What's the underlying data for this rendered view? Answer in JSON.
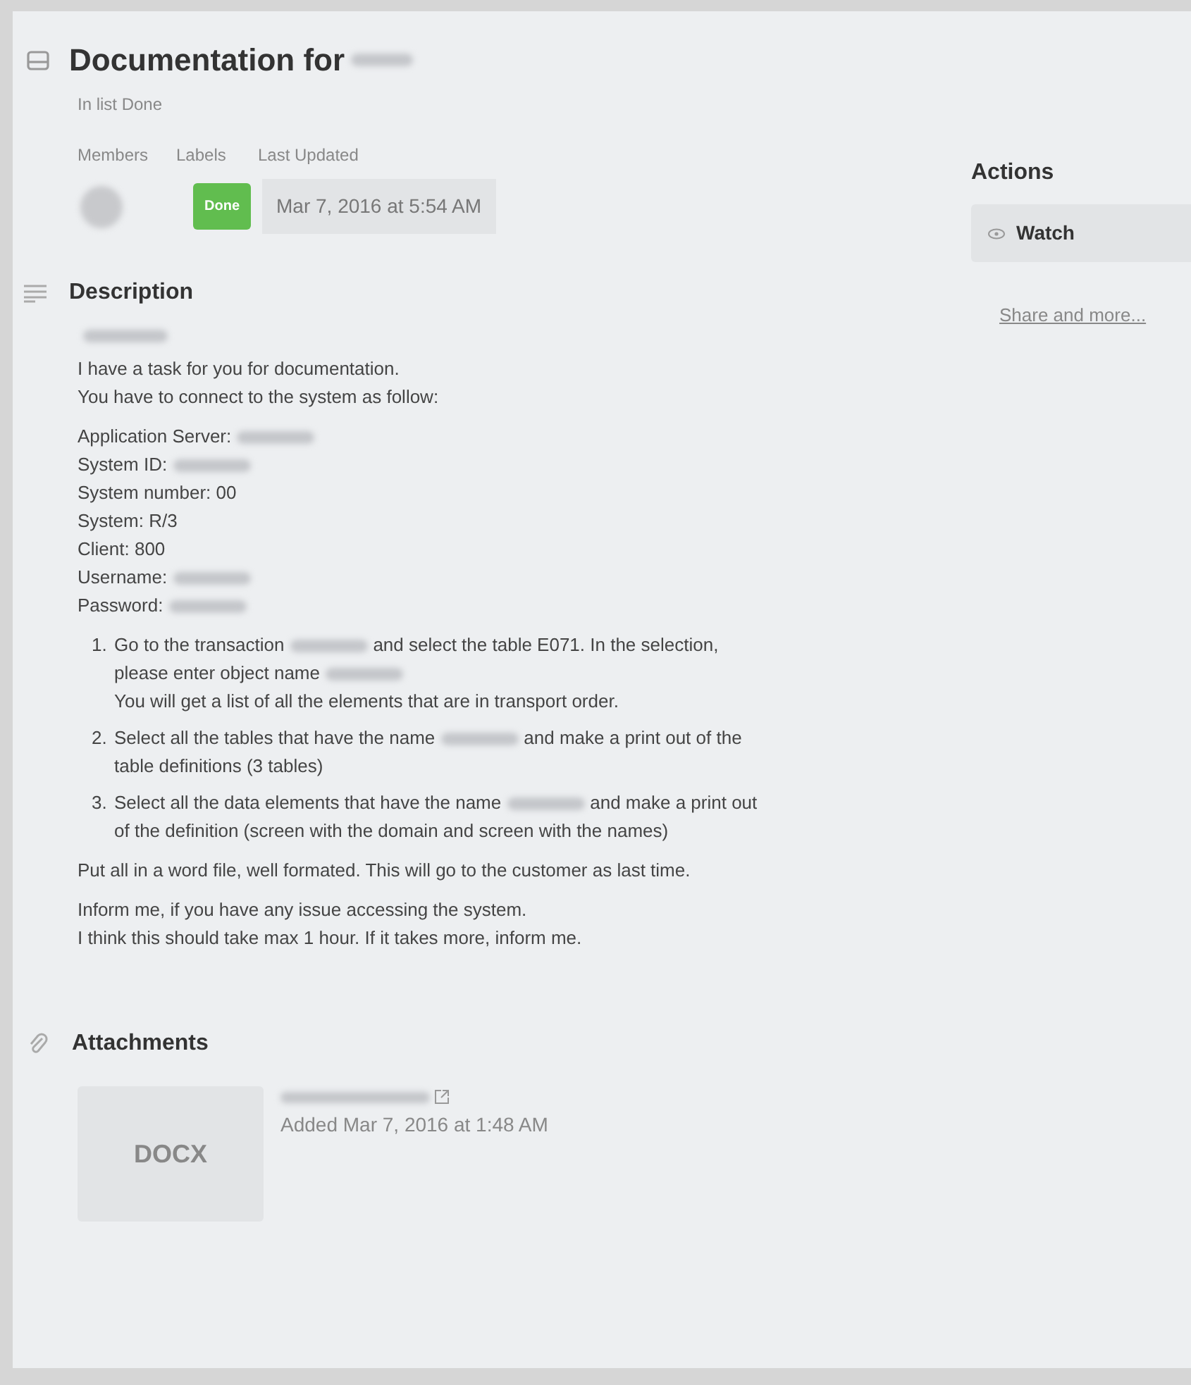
{
  "card": {
    "title": [
      {
        "kind": "text",
        "text": "Documentation for"
      },
      {
        "kind": "redacted"
      }
    ],
    "list_name": "In list Done",
    "meta_headings": [
      "Members",
      "Labels",
      "Last Updated"
    ],
    "member": {
      "kind": "redacted"
    },
    "label": {
      "text": "Done",
      "color": "#61bd4f"
    },
    "last_updated": "Mar 7, 2016 at 5:54 AM"
  },
  "description": {
    "heading": "Description",
    "blocks": [
      {
        "kind": "para",
        "lines": [
          [
            {
              "kind": "redacted"
            }
          ]
        ]
      },
      {
        "kind": "para",
        "lines": [
          [
            {
              "kind": "text",
              "text": "I have a task for you for documentation."
            }
          ],
          [
            {
              "kind": "text",
              "text": "You have to connect to the system as follow:"
            }
          ]
        ]
      },
      {
        "kind": "para",
        "lines": [
          [
            {
              "kind": "text",
              "text": "Application Server:"
            },
            {
              "kind": "redacted"
            }
          ],
          [
            {
              "kind": "text",
              "text": "System ID:"
            },
            {
              "kind": "redacted"
            }
          ],
          [
            {
              "kind": "text",
              "text": "System number: 00"
            }
          ],
          [
            {
              "kind": "text",
              "text": "System: R/3"
            }
          ],
          [
            {
              "kind": "text",
              "text": "Client: 800"
            }
          ],
          [
            {
              "kind": "text",
              "text": "Username:"
            },
            {
              "kind": "redacted"
            }
          ],
          [
            {
              "kind": "text",
              "text": "Password:"
            },
            {
              "kind": "redacted"
            }
          ]
        ]
      },
      {
        "kind": "list",
        "items": [
          {
            "number": "1.",
            "lines": [
              [
                {
                  "kind": "text",
                  "text": "Go to the transaction"
                },
                {
                  "kind": "redacted"
                },
                {
                  "kind": "text",
                  "text": "and select the table E071. In the selection,"
                }
              ],
              [
                {
                  "kind": "text",
                  "text": "please enter object name"
                },
                {
                  "kind": "redacted"
                }
              ],
              [
                {
                  "kind": "text",
                  "text": "You will get a list of all the elements that are in transport order."
                }
              ]
            ]
          },
          {
            "number": "2.",
            "lines": [
              [
                {
                  "kind": "text",
                  "text": "Select all the tables that have the name"
                },
                {
                  "kind": "redacted"
                },
                {
                  "kind": "text",
                  "text": "and make a print out of the"
                }
              ],
              [
                {
                  "kind": "text",
                  "text": "table definitions (3 tables)"
                }
              ]
            ]
          },
          {
            "number": "3.",
            "lines": [
              [
                {
                  "kind": "text",
                  "text": "Select all the data elements that have the name"
                },
                {
                  "kind": "redacted"
                },
                {
                  "kind": "text",
                  "text": "and make a print out"
                }
              ],
              [
                {
                  "kind": "text",
                  "text": "of the definition (screen with the domain and screen with the names)"
                }
              ]
            ]
          }
        ]
      },
      {
        "kind": "para",
        "lines": [
          [
            {
              "kind": "text",
              "text": "Put all in a word file, well formated. This will go to the customer as last time."
            }
          ]
        ]
      },
      {
        "kind": "para",
        "lines": [
          [
            {
              "kind": "text",
              "text": "Inform me, if you have any issue accessing the system."
            }
          ],
          [
            {
              "kind": "text",
              "text": "I think this should take max 1 hour. If it takes more, inform me."
            }
          ]
        ]
      }
    ]
  },
  "attachments": {
    "heading": "Attachments",
    "items": [
      {
        "thumb": "DOCX",
        "name": {
          "kind": "redacted"
        },
        "added": "Added Mar 7, 2016 at 1:48 AM"
      }
    ]
  },
  "sidebar": {
    "heading": "Actions",
    "buttons": [
      "Watch"
    ],
    "link": "Share and more..."
  }
}
